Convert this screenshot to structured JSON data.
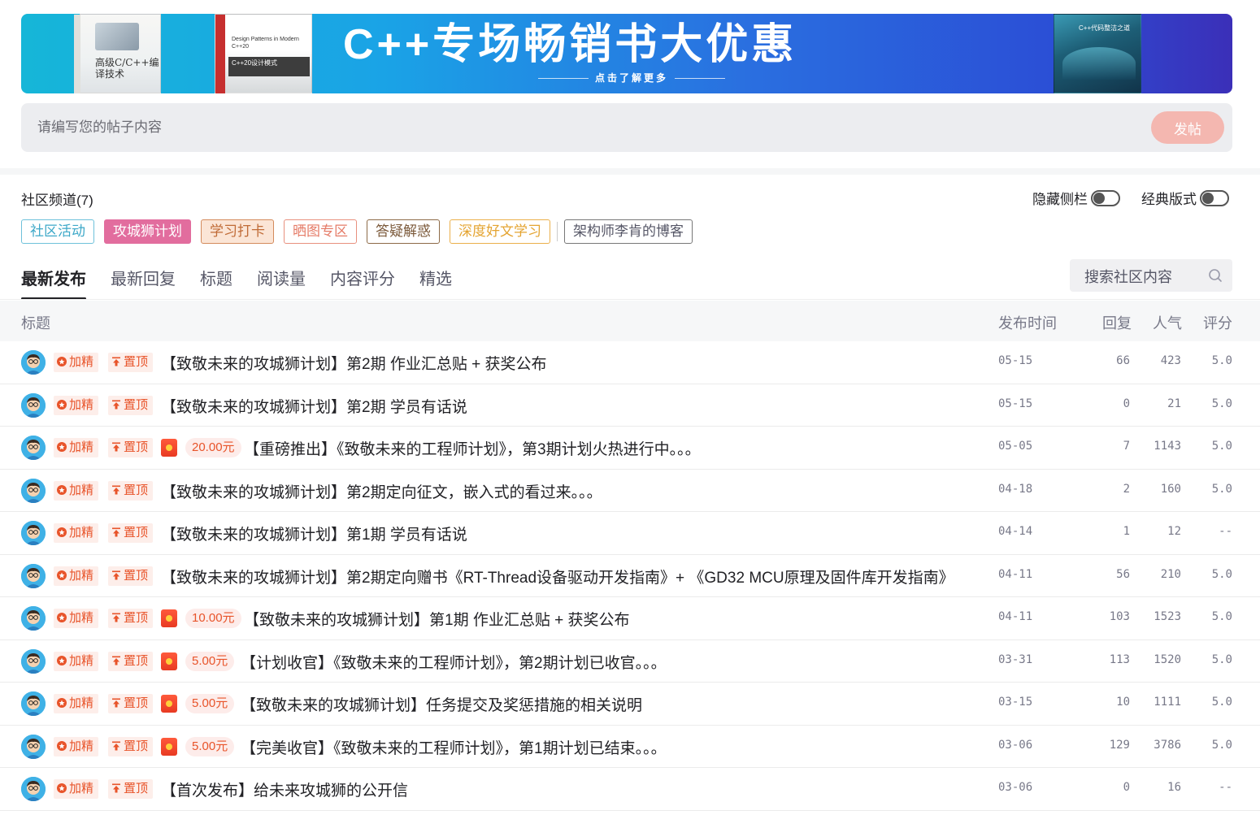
{
  "banner": {
    "title": "C++专场畅销书大优惠",
    "subtitle": "点击了解更多",
    "book1_title": "高级C/C++编译技术",
    "book2_title": "Design Patterns in Modern C++20",
    "book2_band": "C++20设计模式",
    "book3_title": "C++代码整洁之道"
  },
  "post": {
    "placeholder": "请编写您的帖子内容",
    "button": "发帖"
  },
  "channel": {
    "title": "社区频道(7)",
    "hide_sidebar": "隐藏侧栏",
    "classic_layout": "经典版式",
    "tags": [
      "社区活动",
      "攻城狮计划",
      "学习打卡",
      "晒图专区",
      "答疑解惑",
      "深度好文学习",
      "架构师李肯的博客"
    ]
  },
  "tabs": [
    "最新发布",
    "最新回复",
    "标题",
    "阅读量",
    "内容评分",
    "精选"
  ],
  "search": {
    "placeholder": "搜索社区内容"
  },
  "table": {
    "headers": {
      "title": "标题",
      "date": "发布时间",
      "reply": "回复",
      "pop": "人气",
      "score": "评分"
    },
    "badge_jing": "加精",
    "badge_top": "置顶",
    "rows": [
      {
        "money": "",
        "title": "【致敬未来的攻城狮计划】第2期 作业汇总贴 + 获奖公布",
        "date": "05-15",
        "reply": "66",
        "pop": "423",
        "score": "5.0"
      },
      {
        "money": "",
        "title": "【致敬未来的攻城狮计划】第2期 学员有话说",
        "date": "05-15",
        "reply": "0",
        "pop": "21",
        "score": "5.0"
      },
      {
        "money": "20.00元",
        "title": "【重磅推出】《致敬未来的工程师计划》，第3期计划火热进行中。。。",
        "date": "05-05",
        "reply": "7",
        "pop": "1143",
        "score": "5.0"
      },
      {
        "money": "",
        "title": "【致敬未来的攻城狮计划】第2期定向征文，嵌入式的看过来。。。",
        "date": "04-18",
        "reply": "2",
        "pop": "160",
        "score": "5.0"
      },
      {
        "money": "",
        "title": "【致敬未来的攻城狮计划】第1期 学员有话说",
        "date": "04-14",
        "reply": "1",
        "pop": "12",
        "score": "--"
      },
      {
        "money": "",
        "title": "【致敬未来的攻城狮计划】第2期定向赠书《RT-Thread设备驱动开发指南》+ 《GD32 MCU原理及固件库开发指南》",
        "date": "04-11",
        "reply": "56",
        "pop": "210",
        "score": "5.0"
      },
      {
        "money": "10.00元",
        "title": "【致敬未来的攻城狮计划】第1期 作业汇总贴 + 获奖公布",
        "date": "04-11",
        "reply": "103",
        "pop": "1523",
        "score": "5.0"
      },
      {
        "money": "5.00元",
        "title": "【计划收官】《致敬未来的工程师计划》，第2期计划已收官。。。",
        "date": "03-31",
        "reply": "113",
        "pop": "1520",
        "score": "5.0"
      },
      {
        "money": "5.00元",
        "title": "【致敬未来的攻城狮计划】任务提交及奖惩措施的相关说明",
        "date": "03-15",
        "reply": "10",
        "pop": "1111",
        "score": "5.0"
      },
      {
        "money": "5.00元",
        "title": "【完美收官】《致敬未来的工程师计划》，第1期计划已结束。。。",
        "date": "03-06",
        "reply": "129",
        "pop": "3786",
        "score": "5.0"
      },
      {
        "money": "",
        "title": "【首次发布】给未来攻城狮的公开信",
        "date": "03-06",
        "reply": "0",
        "pop": "16",
        "score": "--"
      }
    ]
  },
  "colors": {
    "accent_red": "#e8542a",
    "post_button": "#f4b7b0",
    "tag_active": "#e26d9e"
  }
}
